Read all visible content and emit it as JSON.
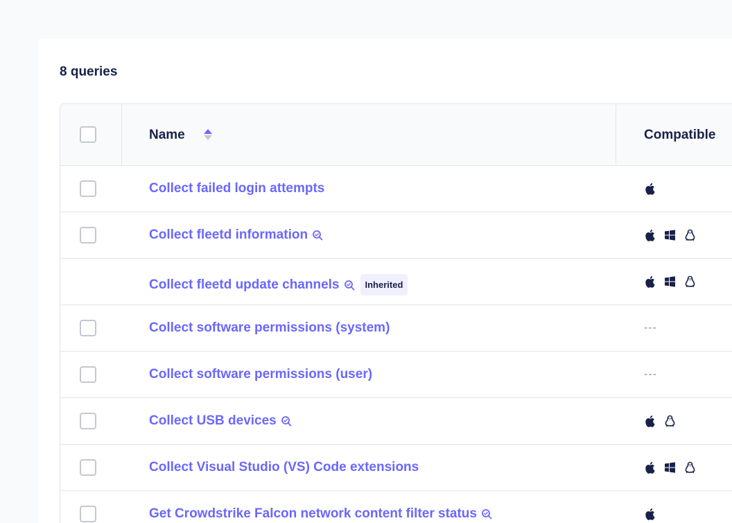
{
  "summary": {
    "count_label": "8 queries"
  },
  "table": {
    "columns": {
      "name": "Name",
      "compatible": "Compatible"
    },
    "rows": [
      {
        "name": "Collect failed login attempts",
        "inspect": false,
        "badge": "",
        "checkbox": true,
        "platforms": [
          "apple-icon"
        ],
        "empty_platforms": ""
      },
      {
        "name": "Collect fleetd information",
        "inspect": true,
        "badge": "",
        "checkbox": true,
        "platforms": [
          "apple-icon",
          "windows-icon",
          "linux-icon"
        ],
        "empty_platforms": ""
      },
      {
        "name": "Collect fleetd update channels",
        "inspect": true,
        "badge": "Inherited",
        "checkbox": false,
        "platforms": [
          "apple-icon",
          "windows-icon",
          "linux-icon"
        ],
        "empty_platforms": ""
      },
      {
        "name": "Collect software permissions (system)",
        "inspect": false,
        "badge": "",
        "checkbox": true,
        "platforms": [],
        "empty_platforms": "---"
      },
      {
        "name": "Collect software permissions (user)",
        "inspect": false,
        "badge": "",
        "checkbox": true,
        "platforms": [],
        "empty_platforms": "---"
      },
      {
        "name": "Collect USB devices",
        "inspect": true,
        "badge": "",
        "checkbox": true,
        "platforms": [
          "apple-icon",
          "linux-icon"
        ],
        "empty_platforms": ""
      },
      {
        "name": "Collect Visual Studio (VS) Code extensions",
        "inspect": false,
        "badge": "",
        "checkbox": true,
        "platforms": [
          "apple-icon",
          "windows-icon",
          "linux-icon"
        ],
        "empty_platforms": ""
      },
      {
        "name": "Get Crowdstrike Falcon network content filter status",
        "inspect": true,
        "badge": "",
        "checkbox": true,
        "platforms": [
          "apple-icon"
        ],
        "empty_platforms": ""
      }
    ]
  },
  "colors": {
    "link": "#6a67fe",
    "text": "#192147",
    "border": "#e2e4ea",
    "sort_active": "#6a67fe",
    "sort_inactive": "#c5c7d1"
  }
}
